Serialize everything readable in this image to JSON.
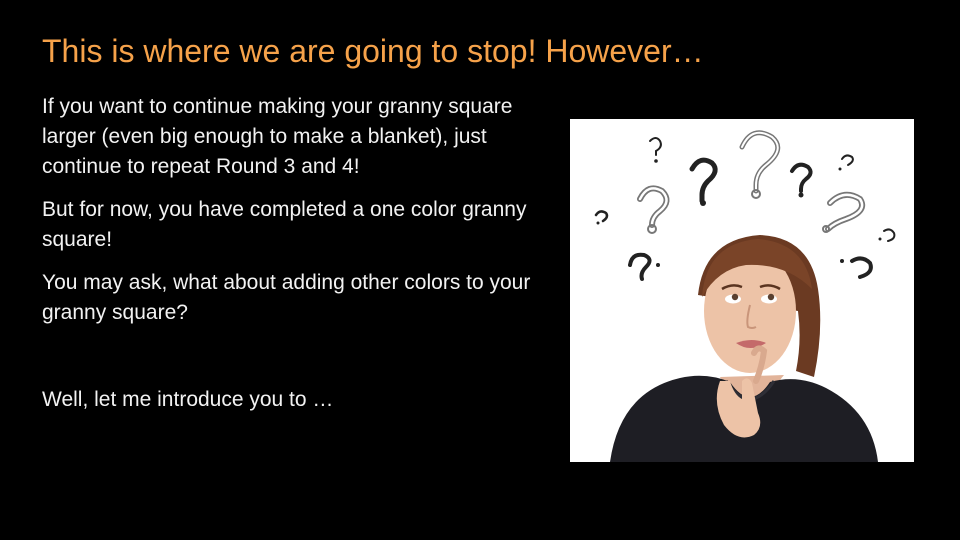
{
  "slide": {
    "title": "This is where we are going to stop! However…",
    "paragraphs": [
      "If you want to continue making your granny square larger (even big enough to make a blanket), just continue to repeat Round 3 and 4!",
      "But for now, you have completed a one color granny square!",
      "You may ask, what about adding other colors to your granny square?",
      "Well, let me introduce you to …"
    ]
  },
  "colors": {
    "background": "#000000",
    "title": "#f6a24a",
    "body_text": "#f2f2f2",
    "photo_background": "#ffffff"
  },
  "image": {
    "subject": "thinking-woman-with-question-marks-icon"
  }
}
